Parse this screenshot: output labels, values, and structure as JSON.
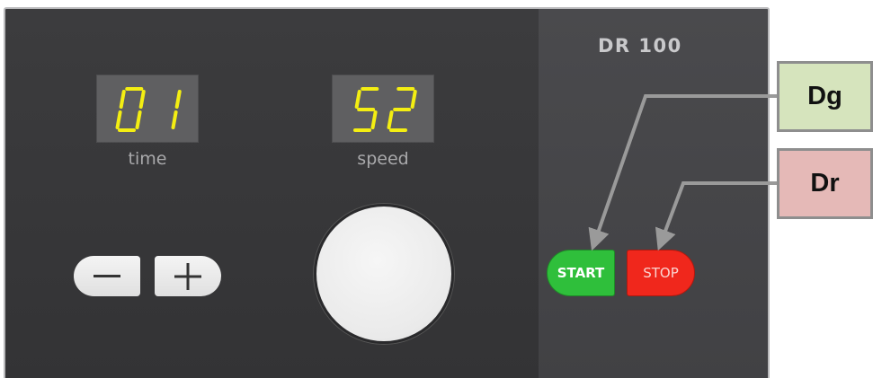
{
  "device": {
    "model": "DR 100"
  },
  "displays": {
    "time": {
      "value": "01",
      "label": "time"
    },
    "speed": {
      "value": "52",
      "label": "speed"
    }
  },
  "buttons": {
    "minus_symbol": "−",
    "plus_symbol": "+",
    "start_label": "START",
    "stop_label": "STOP"
  },
  "callouts": {
    "green": "Dg",
    "red": "Dr"
  },
  "colors": {
    "segment_yellow": "#f4ee12",
    "start_green": "#2fbf3b",
    "stop_red": "#f0271c",
    "callout_green_bg": "#d6e4bd",
    "callout_red_bg": "#e5b9b7"
  },
  "icons": [
    "minus-icon",
    "plus-icon"
  ]
}
